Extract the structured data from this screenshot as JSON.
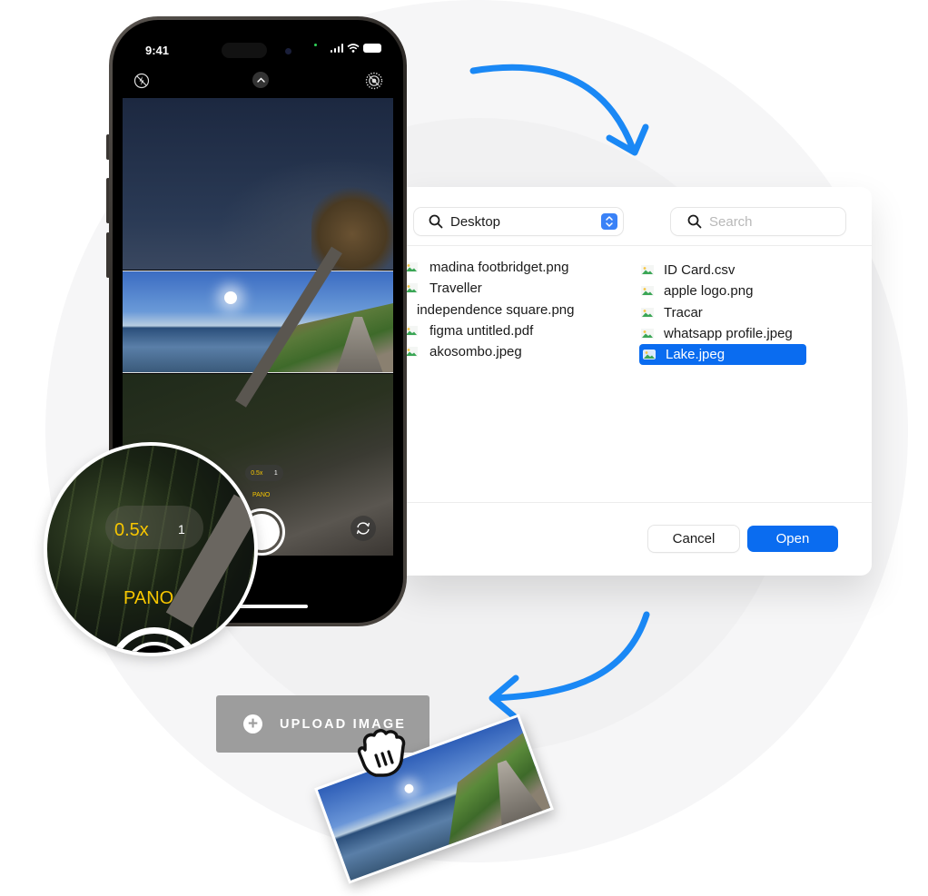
{
  "phone": {
    "status_time": "9:41",
    "zoom_options": [
      "0.5x",
      "1"
    ],
    "active_zoom": "0.5x",
    "mode": "PANO",
    "accent_yellow": "#f7c600"
  },
  "magnifier": {
    "zoom_active": "0.5x",
    "zoom_other": "1",
    "mode": "PANO"
  },
  "dialog": {
    "location": "Desktop",
    "search_placeholder": "Search",
    "search_value": "",
    "files_left": [
      {
        "name": "madina footbridget.png"
      },
      {
        "name": "Traveller"
      },
      {
        "name": "independence square.png"
      },
      {
        "name": "figma untitled.pdf"
      },
      {
        "name": "akosombo.jpeg"
      }
    ],
    "files_right": [
      {
        "name": "ID Card.csv"
      },
      {
        "name": "apple logo.png"
      },
      {
        "name": "Tracar"
      },
      {
        "name": "whatsapp profile.jpeg"
      },
      {
        "name": "Lake.jpeg",
        "selected": true
      }
    ],
    "cancel_label": "Cancel",
    "open_label": "Open",
    "accent": "#0a6cf0"
  },
  "upload": {
    "label": "UPLOAD IMAGE",
    "button_color": "#9d9d9d"
  },
  "arrows": {
    "color": "#1a88f5"
  }
}
